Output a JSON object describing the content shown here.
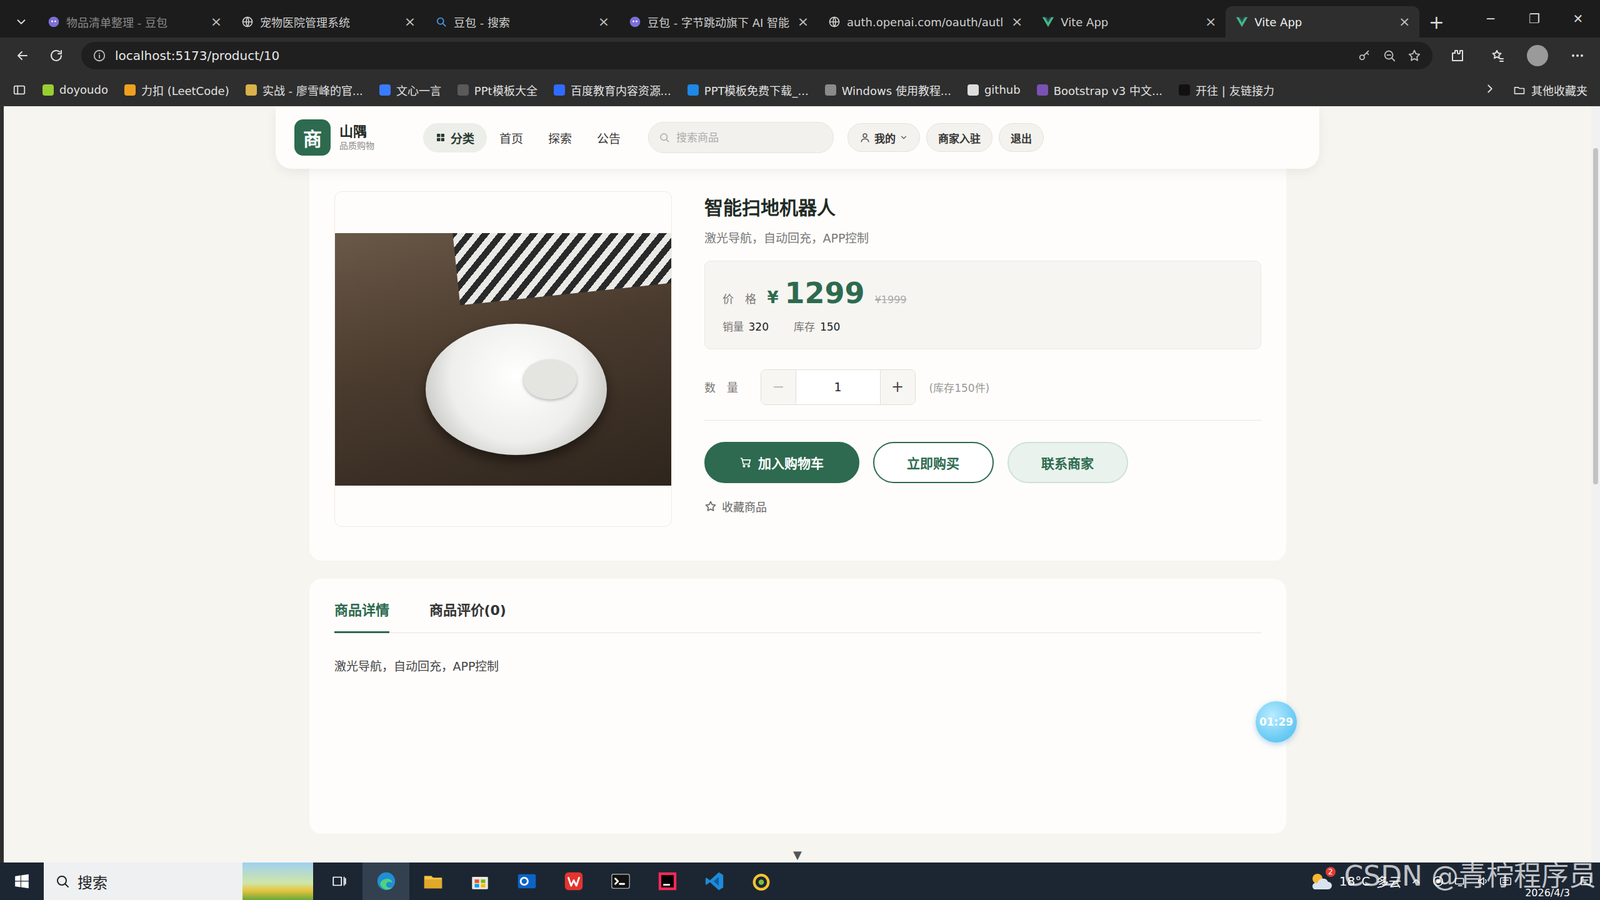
{
  "browser": {
    "tabs": [
      {
        "label": "物品清单整理 - 豆包",
        "selected": false,
        "dimmed": true,
        "kind": "doubao"
      },
      {
        "label": "宠物医院管理系统",
        "selected": false,
        "dimmed": false,
        "kind": "globe"
      },
      {
        "label": "豆包 - 搜索",
        "selected": false,
        "dimmed": false,
        "kind": "search"
      },
      {
        "label": "豆包 - 字节跳动旗下 AI 智能",
        "selected": false,
        "dimmed": false,
        "kind": "doubao"
      },
      {
        "label": "auth.openai.com/oauth/autl",
        "selected": false,
        "dimmed": false,
        "kind": "globe"
      },
      {
        "label": "Vite App",
        "selected": false,
        "dimmed": false,
        "kind": "vite"
      },
      {
        "label": "Vite App",
        "selected": true,
        "dimmed": false,
        "kind": "vite"
      }
    ],
    "tab_close": "×",
    "new_tab": "+",
    "window_controls": [
      "─",
      "❐",
      "✕"
    ],
    "address": "localhost:5173/product/10",
    "bookmarks": [
      {
        "label": "doyoudo",
        "color": "#9acd32"
      },
      {
        "label": "力扣 (LeetCode)",
        "color": "#f0a020"
      },
      {
        "label": "实战 - 廖雪峰的官...",
        "color": "#d9b24a"
      },
      {
        "label": "文心一言",
        "color": "#3a7bff"
      },
      {
        "label": "PPt模板大全",
        "color": "#5a5a5a"
      },
      {
        "label": "百度教育内容资源...",
        "color": "#2f6bff"
      },
      {
        "label": "PPT模板免费下载_...",
        "color": "#1e88e5"
      },
      {
        "label": "Windows 使用教程...",
        "color": "#8a8a8a"
      },
      {
        "label": "github",
        "color": "#dddddd"
      },
      {
        "label": "Bootstrap v3 中文...",
        "color": "#7952b3"
      },
      {
        "label": "开往 | 友链接力",
        "color": "#111111"
      }
    ],
    "other_bookmarks": "其他收藏夹"
  },
  "site": {
    "logo": "商",
    "name": "山隅",
    "tagline": "品质购物",
    "nav": [
      {
        "label": "分类",
        "selected": true
      },
      {
        "label": "首页",
        "selected": false
      },
      {
        "label": "探索",
        "selected": false
      },
      {
        "label": "公告",
        "selected": false
      }
    ],
    "search": {
      "placeholder": "搜索商品"
    },
    "user_menu": "我的",
    "actions": [
      "商家入驻",
      "退出"
    ]
  },
  "product": {
    "title": "智能扫地机器人",
    "subtitle": "激光导航，自动回充，APP控制",
    "price_label": "价　格",
    "currency": "¥",
    "price": "1299",
    "original_price": "¥1999",
    "sales_label": "销量",
    "sales": "320",
    "stock_label": "库存",
    "stock": "150",
    "quantity_label": "数　量",
    "minus": "−",
    "minus_disabled": true,
    "quantity": "1",
    "plus": "+",
    "stock_note": "(库存150件)",
    "buttons": [
      {
        "label": "加入购物车",
        "kind": "primary"
      },
      {
        "label": "立即购买",
        "kind": "outline"
      },
      {
        "label": "联系商家",
        "kind": "soft"
      }
    ],
    "favorite": "收藏商品"
  },
  "details": {
    "tabs": [
      {
        "label": "商品详情",
        "selected": true
      },
      {
        "label": "商品评价(0)",
        "selected": false
      }
    ],
    "content": "激光导航，自动回充，APP控制"
  },
  "timer": "01:29",
  "scroll_hint": "▼",
  "taskbar": {
    "search": "搜索",
    "apps": [
      {
        "kind": "edge",
        "running": true,
        "selected": true
      },
      {
        "kind": "explorer",
        "running": true,
        "selected": false
      },
      {
        "kind": "store",
        "running": false,
        "selected": false
      },
      {
        "kind": "outlook",
        "running": false,
        "selected": false
      },
      {
        "kind": "wps",
        "running": true,
        "selected": false
      },
      {
        "kind": "terminal",
        "running": true,
        "selected": false
      },
      {
        "kind": "idea",
        "running": true,
        "selected": false
      },
      {
        "kind": "vscode",
        "running": true,
        "selected": false
      },
      {
        "kind": "nutstore",
        "running": true,
        "selected": false
      }
    ],
    "weather_badge": "2",
    "temperature": "18°C",
    "weather": "多云",
    "date": "2026/4/3"
  },
  "watermark": "CSDN @青柠程序员"
}
